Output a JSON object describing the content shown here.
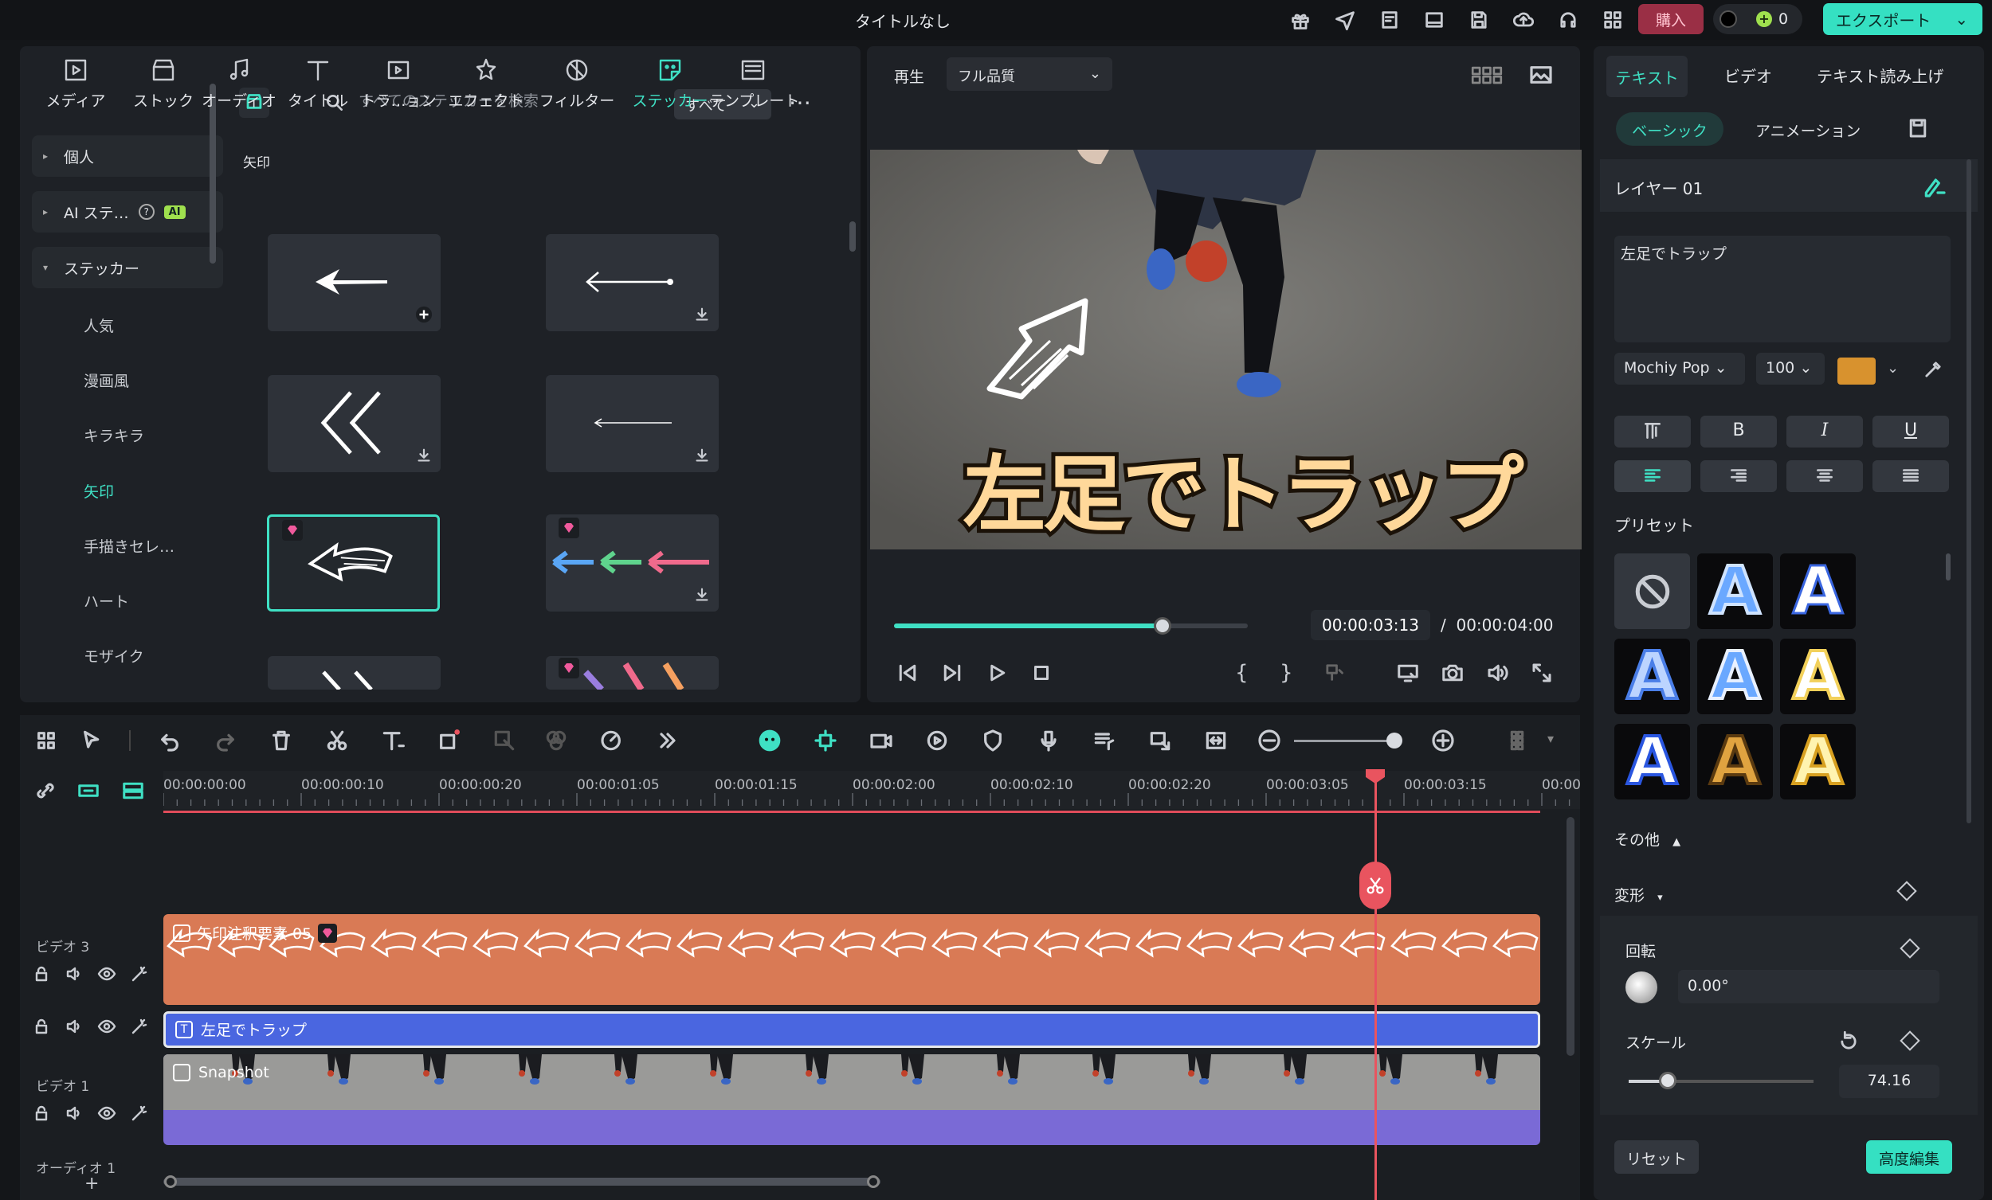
{
  "window": {
    "title": "タイトルなし"
  },
  "titlebar": {
    "buy_label": "購入",
    "credits": "0",
    "export_label": "エクスポート"
  },
  "media_tabs": [
    {
      "label": "メディア",
      "icon": "media-icon"
    },
    {
      "label": "ストック",
      "icon": "stock-icon"
    },
    {
      "label": "オーディオ",
      "icon": "audio-icon"
    },
    {
      "label": "タイトル",
      "icon": "title-icon"
    },
    {
      "label": "トラ…ョン",
      "icon": "transition-icon"
    },
    {
      "label": "エフェクト",
      "icon": "effect-icon"
    },
    {
      "label": "フィルター",
      "icon": "filter-icon"
    },
    {
      "label": "ステッカー",
      "icon": "sticker-icon",
      "active": true
    },
    {
      "label": "テンプレート",
      "icon": "template-icon"
    }
  ],
  "sidebar": {
    "groups": [
      {
        "label": "個人"
      },
      {
        "label": "AI ステ…",
        "badge": "AI"
      },
      {
        "label": "ステッカー"
      }
    ],
    "items": [
      {
        "label": "人気"
      },
      {
        "label": "漫画風"
      },
      {
        "label": "キラキラ"
      },
      {
        "label": "矢印",
        "active": true
      },
      {
        "label": "手描きセレ…"
      },
      {
        "label": "ハート"
      },
      {
        "label": "モザイク"
      }
    ]
  },
  "search": {
    "placeholder": "すべてのステッカーを検索",
    "filter_label": "すべて"
  },
  "sticker_category": "矢印",
  "preview": {
    "play_label": "再生",
    "quality_label": "フル品質",
    "caption": "左足でトラップ",
    "progress": 0.76,
    "current_time": "00:00:03:13",
    "separator": "/",
    "total_time": "00:00:04:00"
  },
  "right_panel": {
    "tabs": [
      "テキスト",
      "ビデオ",
      "テキスト読み上げ"
    ],
    "subtabs": [
      "ベーシック",
      "アニメーション"
    ],
    "layer_name": "レイヤー 01",
    "text_value": "左足でトラップ",
    "font": "Mochiy Pop",
    "font_size": "100",
    "text_color": "#d8922e",
    "format_buttons": [
      "B",
      "I",
      "U"
    ],
    "preset_label": "プリセット",
    "preset_letter": "A",
    "other_label": "その他",
    "transform_label": "変形",
    "rotation_label": "回転",
    "rotation_value": "0.00°",
    "scale_label": "スケール",
    "scale_value": "74.16",
    "reset_label": "リセット",
    "advanced_label": "高度編集"
  },
  "timeline": {
    "ticks": [
      "00:00:00:00",
      "00:00:00:10",
      "00:00:00:20",
      "00:00:01:05",
      "00:00:01:15",
      "00:00:02:00",
      "00:00:02:10",
      "00:00:02:20",
      "00:00:03:05",
      "00:00:03:15",
      "00:00"
    ],
    "tracks": [
      {
        "name": "ビデオ 3",
        "clip": "矢印注釈要素 05"
      },
      {
        "name": "",
        "clip": "左足でトラップ"
      },
      {
        "name": "ビデオ 1",
        "clip": "Snapshot"
      },
      {
        "name": "オーディオ 1",
        "clip": ""
      }
    ],
    "playhead_progress": 0.885
  }
}
